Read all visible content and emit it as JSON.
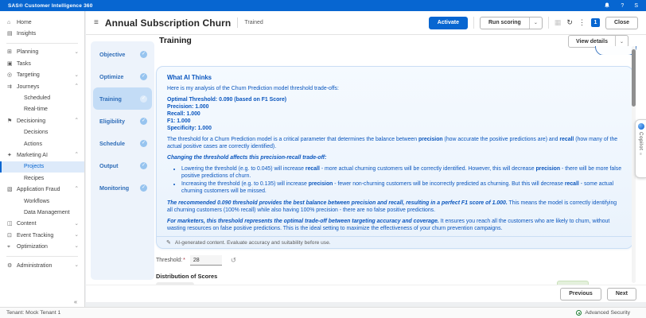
{
  "colors": {
    "accent": "#0766d1",
    "ai_text": "#0a56be",
    "status_green": "#1e7e34",
    "stepper_bg": "#edf3fb",
    "stepper_active_bg": "#c3dcf6"
  },
  "glyphs": {
    "menu": "≡",
    "chevron_down": "⌄",
    "chevron_up": "⌃",
    "save": "▦",
    "refresh": "↻",
    "kebab": "⋮",
    "check": "✓",
    "collapse": "«",
    "reset": "↺",
    "pencil": "✎",
    "grip": "≡"
  },
  "topbar": {
    "brand": "SAS® Customer Intelligence 360",
    "help_glyph": "?",
    "avatar_glyph": "S"
  },
  "sidebar": {
    "items": [
      {
        "id": "home",
        "label": "Home",
        "icon": "⌂",
        "level": 0
      },
      {
        "id": "insights",
        "label": "Insights",
        "icon": "▤",
        "level": 0
      },
      {
        "divider": true
      },
      {
        "id": "planning",
        "label": "Planning",
        "icon": "⊞",
        "level": 0,
        "chevron": "down"
      },
      {
        "id": "tasks",
        "label": "Tasks",
        "icon": "▣",
        "level": 0
      },
      {
        "id": "targeting",
        "label": "Targeting",
        "icon": "◎",
        "level": 0,
        "chevron": "down"
      },
      {
        "id": "journeys",
        "label": "Journeys",
        "icon": "⇉",
        "level": 0,
        "chevron": "up"
      },
      {
        "id": "scheduled",
        "label": "Scheduled",
        "level": 1
      },
      {
        "id": "real-time",
        "label": "Real-time",
        "level": 1
      },
      {
        "id": "decisioning",
        "label": "Decisioning",
        "icon": "⚑",
        "level": 0,
        "chevron": "up"
      },
      {
        "id": "decisions",
        "label": "Decisions",
        "level": 1
      },
      {
        "id": "actions",
        "label": "Actions",
        "level": 1
      },
      {
        "id": "marketing-ai",
        "label": "Marketing AI",
        "icon": "✦",
        "level": 0,
        "chevron": "up"
      },
      {
        "id": "projects",
        "label": "Projects",
        "level": 1,
        "selected": true
      },
      {
        "id": "recipes",
        "label": "Recipes",
        "level": 1
      },
      {
        "id": "application-fraud",
        "label": "Application Fraud",
        "icon": "▧",
        "level": 0,
        "chevron": "up"
      },
      {
        "id": "workflows",
        "label": "Workflows",
        "level": 1
      },
      {
        "id": "data-management",
        "label": "Data Management",
        "level": 1
      },
      {
        "id": "content",
        "label": "Content",
        "icon": "◫",
        "level": 0,
        "chevron": "down"
      },
      {
        "id": "event-tracking",
        "label": "Event Tracking",
        "icon": "⊡",
        "level": 0,
        "chevron": "down"
      },
      {
        "id": "optimization",
        "label": "Optimization",
        "icon": "⌖",
        "level": 0,
        "chevron": "down"
      },
      {
        "divider": true
      },
      {
        "id": "administration",
        "label": "Administration",
        "icon": "⚙",
        "level": 0,
        "chevron": "down"
      }
    ]
  },
  "header": {
    "title": "Annual Subscription Churn",
    "status": "Trained",
    "activate_label": "Activate",
    "run_scoring_label": "Run scoring",
    "badge_count": "1",
    "close_label": "Close"
  },
  "stepper": {
    "items": [
      {
        "label": "Objective",
        "state": "complete"
      },
      {
        "label": "Optimize",
        "state": "complete"
      },
      {
        "label": "Training",
        "state": "active"
      },
      {
        "label": "Eligibility",
        "state": "complete"
      },
      {
        "label": "Schedule",
        "state": "complete"
      },
      {
        "label": "Output",
        "state": "complete"
      },
      {
        "label": "Monitoring",
        "state": "complete"
      }
    ]
  },
  "main": {
    "page_title": "Training",
    "view_details_label": "View details",
    "ai_panel": {
      "title": "What AI Thinks",
      "blocks": [
        {
          "type": "p",
          "segs": [
            {
              "t": "Here is my analysis of the Churn Prediction model threshold trade-offs:"
            }
          ]
        },
        {
          "type": "lines",
          "lines": [
            [
              {
                "t": "Optimal Threshold: 0.090",
                "b": true
              },
              {
                "t": " (based on F1 Score)"
              }
            ],
            [
              {
                "t": "Precision: 1.000",
                "b": true
              }
            ],
            [
              {
                "t": "Recall: 1.000",
                "b": true
              }
            ],
            [
              {
                "t": "F1: 1.000",
                "b": true
              }
            ],
            [
              {
                "t": "Specificity: 1.000",
                "b": true
              }
            ]
          ]
        },
        {
          "type": "p",
          "segs": [
            {
              "t": "The threshold for a Churn Prediction model is a critical parameter that determines the balance between "
            },
            {
              "t": "precision",
              "b": true
            },
            {
              "t": " (how accurate the positive predictions are) and "
            },
            {
              "t": "recall",
              "b": true
            },
            {
              "t": " (how many of the actual positive cases are correctly identified)."
            }
          ]
        },
        {
          "type": "p",
          "segs": [
            {
              "t": "Changing the threshold affects this precision-recall trade-off:",
              "b": true,
              "i": true
            }
          ]
        },
        {
          "type": "bullets",
          "items": [
            [
              {
                "t": "Lowering the threshold (e.g. to 0.045) will increase "
              },
              {
                "t": "recall",
                "b": true
              },
              {
                "t": " - more actual churning customers will be correctly identified. However, this will decrease "
              },
              {
                "t": "precision",
                "b": true
              },
              {
                "t": " - there will be more false positive predictions of churn."
              }
            ],
            [
              {
                "t": "Increasing the threshold (e.g. to 0.135) will increase "
              },
              {
                "t": "precision",
                "b": true
              },
              {
                "t": " - fewer non-churning customers will be incorrectly predicted as churning. But this will decrease "
              },
              {
                "t": "recall",
                "b": true
              },
              {
                "t": " - some actual churning customers will be missed."
              }
            ]
          ]
        },
        {
          "type": "p",
          "segs": [
            {
              "t": "The recommended 0.090 threshold provides the best balance between precision and recall, resulting in a perfect F1 score of 1.000.",
              "b": true,
              "i": true
            },
            {
              "t": " This means the model is correctly identifying all churning customers (100% recall) while also having 100% precision - there are no false positive predictions."
            }
          ]
        },
        {
          "type": "p",
          "segs": [
            {
              "t": "For marketers, this threshold represents the optimal trade-off between targeting accuracy and coverage.",
              "b": true,
              "i": true
            },
            {
              "t": " It ensures you reach all the customers who are likely to churn, without wasting resources on false positive predictions. This is the ideal setting to maximize the effectiveness of your churn prevention campaigns."
            }
          ]
        }
      ],
      "footer_note": "AI-generated content. Evaluate accuracy and suitability before use."
    },
    "threshold": {
      "label": "Threshold:",
      "required_mark": "*",
      "value": "28"
    },
    "distribution_title": "Distribution of Scores",
    "previous_label": "Previous",
    "next_label": "Next"
  },
  "copilot": {
    "label": "Copilot"
  },
  "statusbar": {
    "tenant": "Tenant: Mock Tenant 1",
    "security": "Advanced Security"
  }
}
